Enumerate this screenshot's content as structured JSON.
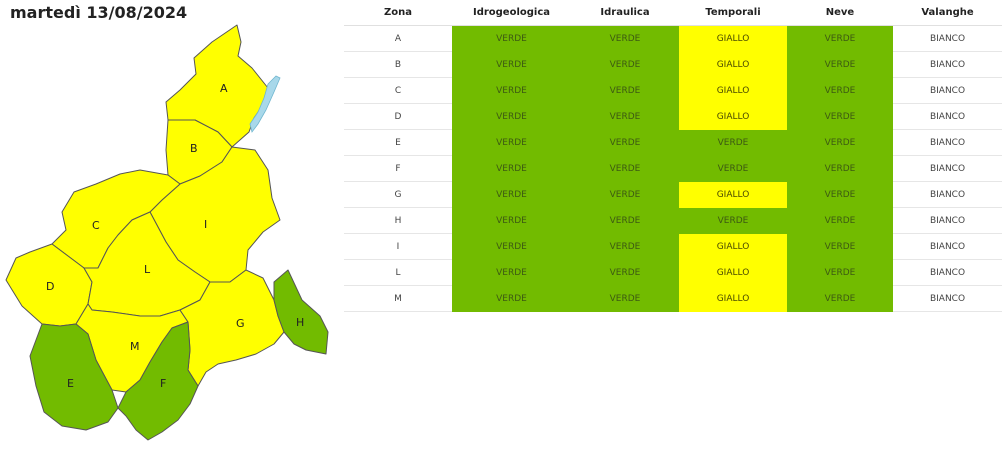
{
  "date_title": "martedì 13/08/2024",
  "colors": {
    "verde": "#72bb00",
    "giallo": "#ffff00",
    "bianco": "#ffffff",
    "lake": "#a8d8ea"
  },
  "map": {
    "zones": [
      {
        "id": "A",
        "level": "giallo"
      },
      {
        "id": "B",
        "level": "giallo"
      },
      {
        "id": "C",
        "level": "giallo"
      },
      {
        "id": "D",
        "level": "giallo"
      },
      {
        "id": "E",
        "level": "verde"
      },
      {
        "id": "F",
        "level": "verde"
      },
      {
        "id": "G",
        "level": "giallo"
      },
      {
        "id": "H",
        "level": "verde"
      },
      {
        "id": "I",
        "level": "giallo"
      },
      {
        "id": "L",
        "level": "giallo"
      },
      {
        "id": "M",
        "level": "giallo"
      }
    ]
  },
  "table": {
    "headers": [
      "Zona",
      "Idrogeologica",
      "Idraulica",
      "Temporali",
      "Neve",
      "Valanghe"
    ],
    "rows": [
      [
        "A",
        "VERDE",
        "VERDE",
        "GIALLO",
        "VERDE",
        "BIANCO"
      ],
      [
        "B",
        "VERDE",
        "VERDE",
        "GIALLO",
        "VERDE",
        "BIANCO"
      ],
      [
        "C",
        "VERDE",
        "VERDE",
        "GIALLO",
        "VERDE",
        "BIANCO"
      ],
      [
        "D",
        "VERDE",
        "VERDE",
        "GIALLO",
        "VERDE",
        "BIANCO"
      ],
      [
        "E",
        "VERDE",
        "VERDE",
        "VERDE",
        "VERDE",
        "BIANCO"
      ],
      [
        "F",
        "VERDE",
        "VERDE",
        "VERDE",
        "VERDE",
        "BIANCO"
      ],
      [
        "G",
        "VERDE",
        "VERDE",
        "GIALLO",
        "VERDE",
        "BIANCO"
      ],
      [
        "H",
        "VERDE",
        "VERDE",
        "VERDE",
        "VERDE",
        "BIANCO"
      ],
      [
        "I",
        "VERDE",
        "VERDE",
        "GIALLO",
        "VERDE",
        "BIANCO"
      ],
      [
        "L",
        "VERDE",
        "VERDE",
        "GIALLO",
        "VERDE",
        "BIANCO"
      ],
      [
        "M",
        "VERDE",
        "VERDE",
        "GIALLO",
        "VERDE",
        "BIANCO"
      ]
    ]
  }
}
